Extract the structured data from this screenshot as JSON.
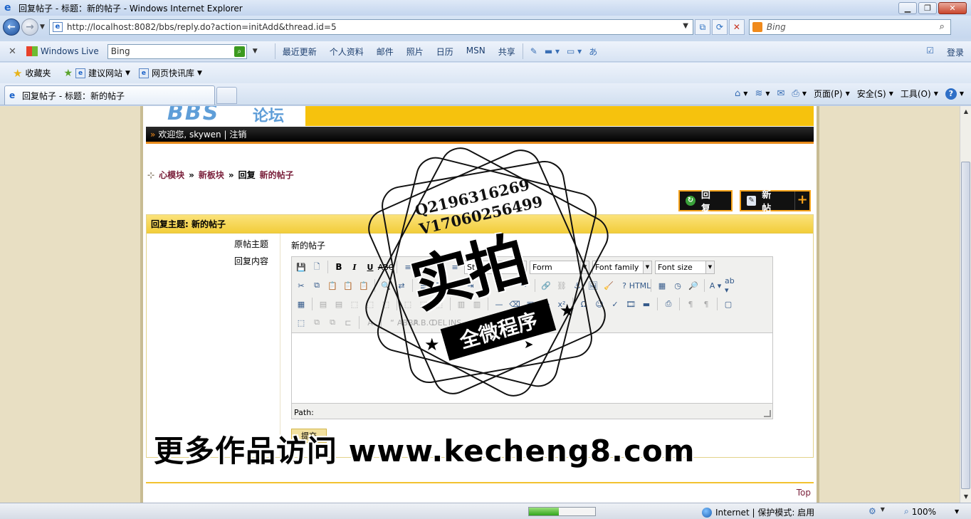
{
  "window": {
    "title": "回复帖子 - 标题：新的帖子 - Windows Internet Explorer",
    "min_label": "▁",
    "max_label": "❐",
    "close_label": "✕"
  },
  "address": {
    "url": "http://localhost:8082/bbs/reply.do?action=initAdd&thread.id=5",
    "search_placeholder": "Bing"
  },
  "live_toolbar": {
    "brand": "Windows Live",
    "search_value": "Bing",
    "links": [
      "最近更新",
      "个人资料",
      "邮件",
      "照片",
      "日历",
      "MSN",
      "共享"
    ],
    "login": "登录"
  },
  "favorites": {
    "label": "收藏夹",
    "items": [
      "建议网站",
      "网页快讯库"
    ]
  },
  "tab": {
    "title": "回复帖子 - 标题：新的帖子"
  },
  "command_bar": {
    "page": "页面(P)",
    "safety": "安全(S)",
    "tools": "工具(O)",
    "help": "?"
  },
  "page": {
    "welcome": "欢迎您, skywen | 注销",
    "breadcrumb": {
      "module": "心模块",
      "board": "新板块",
      "action": "回复",
      "thread": "新的帖子",
      "sep": "»"
    },
    "reply_button": "回 复",
    "new_post_button": "新 帖",
    "form": {
      "header": "回复主题: 新的帖子",
      "original_label": "原帖主题",
      "original_value": "新的帖子",
      "content_label": "回复内容",
      "styles": "Styles",
      "format": "Form",
      "font_family": "Font family",
      "font_size": "Font size",
      "path": "Path:",
      "submit": "提交"
    },
    "top_link": "Top"
  },
  "status": {
    "progress_fraction": 0.45,
    "zone": "Internet | 保护模式: 启用",
    "zoom": "100%"
  },
  "watermark": {
    "contact_q": "Q2196316269",
    "contact_v": "V17060256499",
    "big_text": "实拍",
    "ribbon": "全微程序",
    "promo": "更多作品访问 www.kecheng8.com"
  },
  "colors": {
    "banner": "#f6c20d",
    "form_header": "#f2cd3a",
    "link": "#7a1f3a",
    "button_border": "#f6a21a"
  }
}
